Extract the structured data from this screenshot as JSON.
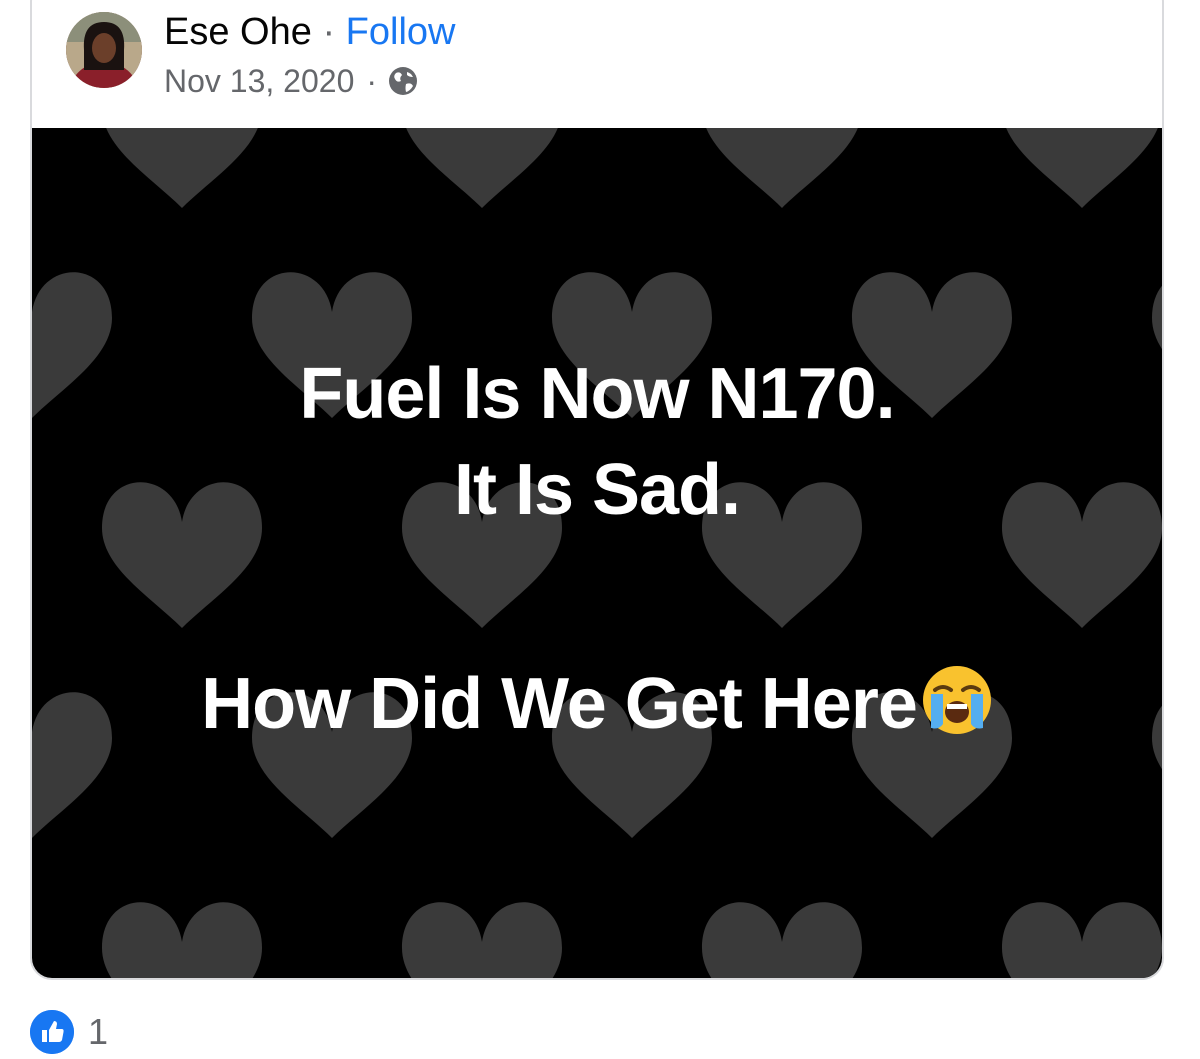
{
  "post": {
    "author_name": "Ese Ohe",
    "separator": "·",
    "follow_label": "Follow",
    "date": "Nov 13, 2020",
    "meta_separator": "·",
    "privacy_icon": "globe-icon"
  },
  "media": {
    "line1": "Fuel Is Now N170.",
    "line2": "It Is Sad.",
    "line3": "How Did We Get Here",
    "emoji": "loudly-crying-face-emoji",
    "background_color": "#000000",
    "heart_color": "#3a3a3a"
  },
  "reactions": {
    "icon": "like-icon",
    "count": "1"
  },
  "colors": {
    "accent": "#1877f2",
    "secondary_text": "#65676b",
    "primary_text": "#050505"
  }
}
